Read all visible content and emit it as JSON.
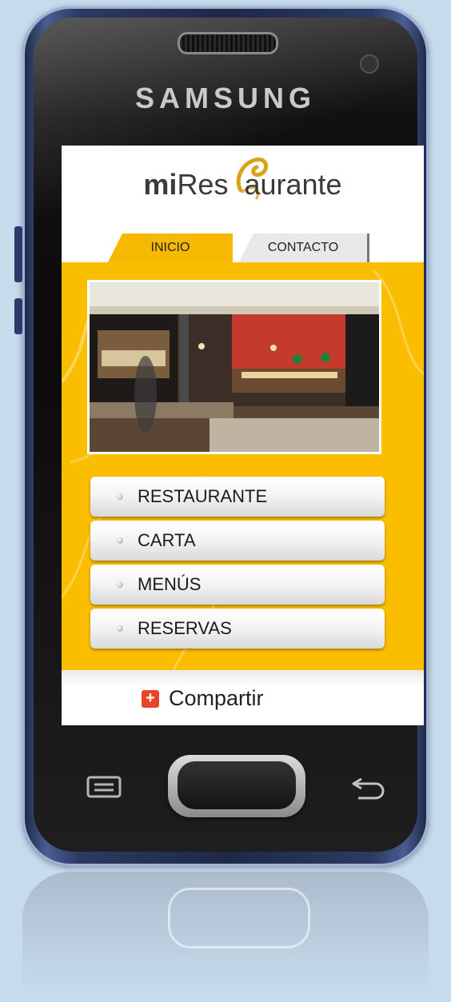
{
  "device": {
    "brand": "SAMSUNG",
    "body_color": "#2c3a62"
  },
  "app": {
    "logo": {
      "bold": "mi",
      "regular_before": "Res",
      "regular_after": "aurante",
      "accent_color": "#d4a017"
    },
    "tabs": [
      {
        "label": "INICIO",
        "active": true
      },
      {
        "label": "CONTACTO",
        "active": false
      }
    ],
    "accent_color": "#fbbd00",
    "hero_image": "restaurant-interior-photo",
    "menu": [
      {
        "label": "RESTAURANTE"
      },
      {
        "label": "CARTA"
      },
      {
        "label": "MENÚS"
      },
      {
        "label": "RESERVAS"
      }
    ],
    "share": {
      "label": "Compartir",
      "icon": "plus-icon",
      "icon_color": "#e8462a"
    }
  },
  "hardware_keys": {
    "menu": "menu-key-icon",
    "home": "home-button",
    "back": "back-arrow-icon"
  }
}
